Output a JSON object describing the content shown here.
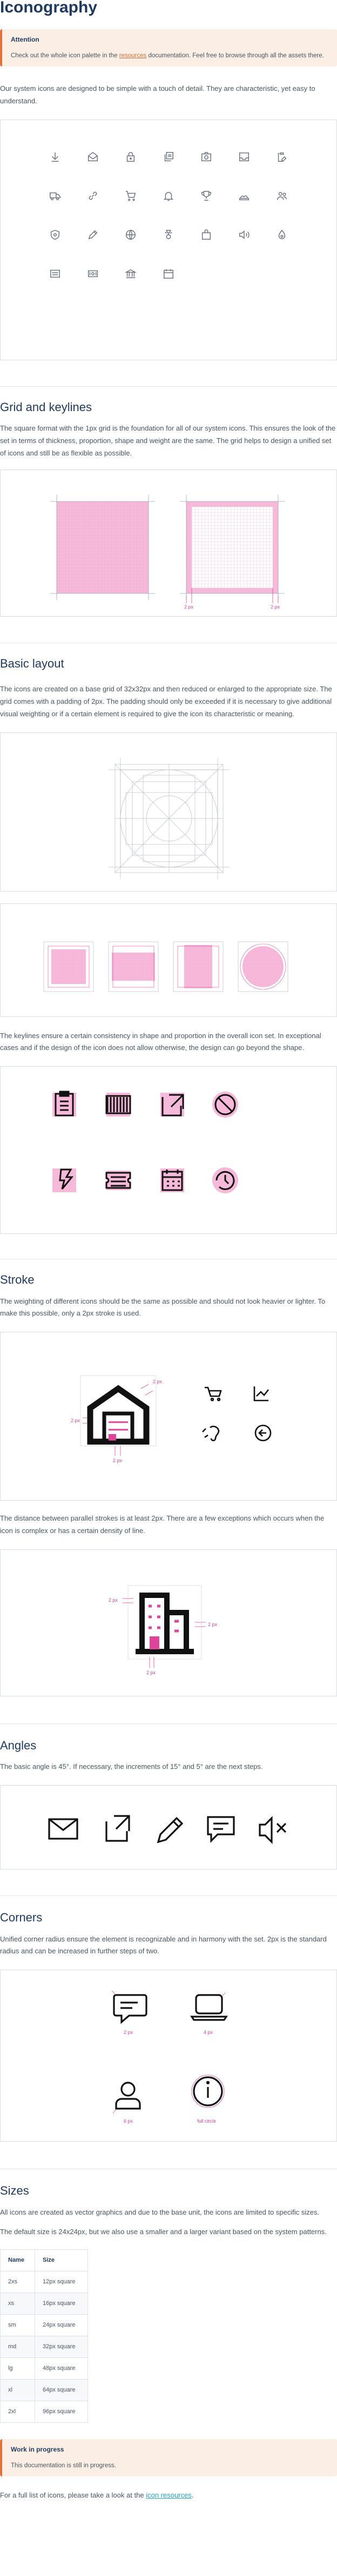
{
  "title": "Iconography",
  "notice": {
    "title": "Attention",
    "text_before": "Check out the whole icon palette in the ",
    "link": "resources",
    "text_after": " documentation. Feel free to browse through all the assets there."
  },
  "intro": "Our system icons are designed to be simple with a touch of detail. They are characteristic, yet easy to understand.",
  "icon_names": [
    "download",
    "mail-open",
    "lock",
    "copy",
    "camera",
    "inbox",
    "clipboard-edit",
    "truck",
    "link",
    "cart",
    "bell",
    "trophy",
    "cloud-shapes",
    "users",
    "shield-virus",
    "pen",
    "globe",
    "award",
    "bag",
    "speaker",
    "temperature",
    "slider-pad",
    "money",
    "bank",
    "calendar"
  ],
  "grid": {
    "heading": "Grid and keylines",
    "text": "The square format with the 1px grid is the foundation for all of our system icons. This ensures the look of the set in terms of thickness, proportion, shape and weight are the same. The grid helps to design a unified set of icons and still be as flexible as possible.",
    "label_2px_a": "2 px",
    "label_2px_b": "2 px"
  },
  "basic": {
    "heading": "Basic layout",
    "text": "The icons are created on a base grid of 32x32px and then reduced or enlarged to the appropriate size. The grid comes with a padding of 2px. The padding should only be exceeded if it is necessary to give additional visual weighting or if a certain element is required to give the icon its characteristic or meaning.",
    "keylines_text": "The keylines ensure a certain consistency in shape and proportion in the overall icon set. In exceptional cases and if the design of the icon does not allow otherwise, the design can go beyond the shape."
  },
  "stroke": {
    "heading": "Stroke",
    "text": "The weighting of different icons should be the same as possible and should not look heavier or lighter. To make this possible, only a 2px stroke is used.",
    "distance_text": "The distance between parallel strokes is at least 2px. There are a few exceptions which occurs when the icon is complex or has a certain density of line.",
    "label_2px": "2 px"
  },
  "angles": {
    "heading": "Angles",
    "text": "The basic angle is 45°. If necessary, the increments of 15° and 5° are the next steps."
  },
  "corners": {
    "heading": "Corners",
    "text": "Unified corner radius ensure the element is recognizable and in harmony with the set. 2px is the standard radius and can be increased in further steps of two.",
    "labels": [
      "2 px",
      "4 px",
      "6 px",
      "full circle"
    ]
  },
  "sizes": {
    "heading": "Sizes",
    "text1": "All icons are created as vector graphics and due to the base unit, the icons are limited to specific sizes.",
    "text2": "The default size is 24x24px, but we also use a smaller and a larger variant based on the system patterns.",
    "columns": [
      "Name",
      "Size"
    ],
    "rows": [
      [
        "2xs",
        "12px square"
      ],
      [
        "xs",
        "16px square"
      ],
      [
        "sm",
        "24px square"
      ],
      [
        "md",
        "32px square"
      ],
      [
        "lg",
        "48px square"
      ],
      [
        "xl",
        "64px square"
      ],
      [
        "2xl",
        "96px square"
      ]
    ]
  },
  "wip": {
    "title": "Work in progress",
    "text": "This documentation is still in progress."
  },
  "footer": {
    "text_before": "For a full list of icons, please take a look at the ",
    "link": "icon resources",
    "text_after": "."
  },
  "colors": {
    "heading": "#1f3a5f",
    "accent": "#e0449a",
    "link": "#e2703a",
    "notice_bg": "#fbeee4"
  }
}
